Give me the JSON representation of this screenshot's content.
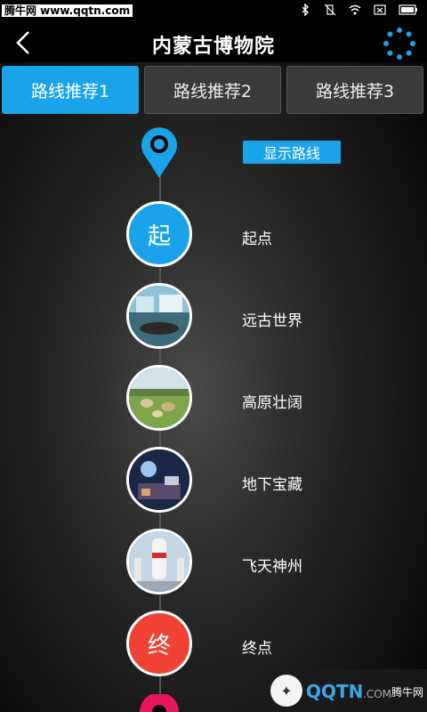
{
  "statusbar": {
    "watermark": "腾牛网 www.qqtn.com"
  },
  "header": {
    "title": "内蒙古博物院"
  },
  "tabs": [
    {
      "label": "路线推荐1",
      "active": true
    },
    {
      "label": "路线推荐2",
      "active": false
    },
    {
      "label": "路线推荐3",
      "active": false
    }
  ],
  "route": {
    "show_button": "显示路线",
    "stops": [
      {
        "char": "起",
        "label": "起点"
      },
      {
        "label": "远古世界"
      },
      {
        "label": "高原壮阔"
      },
      {
        "label": "地下宝藏"
      },
      {
        "label": "飞天神州"
      },
      {
        "char": "终",
        "label": "终点"
      }
    ]
  },
  "colors": {
    "accent": "#1aa3e8",
    "end": "#ef4235",
    "pin_bottom": "#e8175d"
  },
  "bottom_logo": {
    "text": "QQTN",
    "suffix": "腾牛网"
  }
}
